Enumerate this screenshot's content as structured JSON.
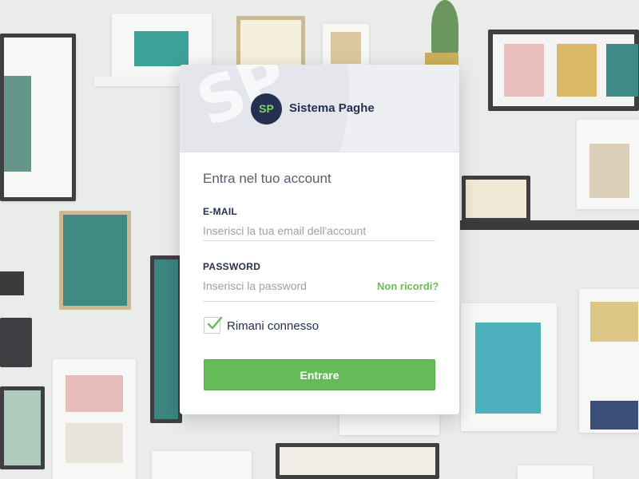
{
  "brand": {
    "initials": "SP",
    "name": "Sistema Paghe",
    "watermark": "SP",
    "accent_color": "#65bb58",
    "navy_color": "#26304f"
  },
  "login": {
    "title": "Entra nel tuo account",
    "email": {
      "label": "E-MAIL",
      "placeholder": "Inserisci la tua email dell'account",
      "value": ""
    },
    "password": {
      "label": "PASSWORD",
      "placeholder": "Inserisci la password",
      "value": "",
      "forgot_label": "Non ricordi?"
    },
    "remember": {
      "label": "Rimani connesso",
      "checked": true
    },
    "submit_label": "Entrare"
  },
  "background": {
    "description_icon": "gallery-wall-image"
  }
}
